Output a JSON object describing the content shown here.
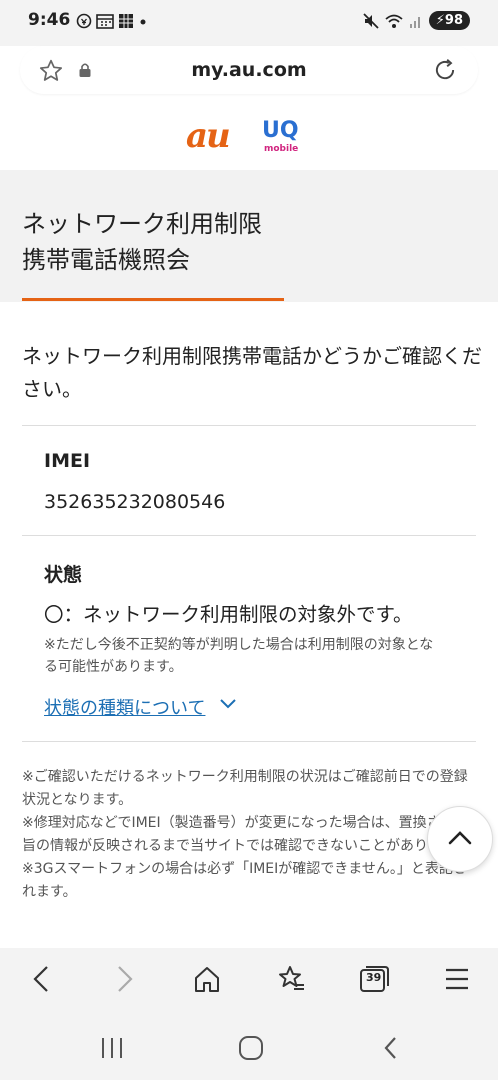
{
  "status_bar": {
    "time": "9:46",
    "battery": "98"
  },
  "browser": {
    "url": "my.au.com",
    "tab_count": "39"
  },
  "logos": {
    "au": "au",
    "uq": "UQ",
    "uq_sub": "mobile"
  },
  "page": {
    "title_line1": "ネットワーク利用制限",
    "title_line2": "携帯電話機照会",
    "intro": "ネットワーク利用制限携帯電話かどうかご確認ください。",
    "imei_label": "IMEI",
    "imei_value": "352635232080546",
    "status_label": "状態",
    "status_value": "〇：ネットワーク利用制限の対象外です。",
    "status_note": "※ただし今後不正契約等が判明した場合は利用制限の対象となる可能性があります。",
    "types_link": "状態の種類について",
    "footnotes": [
      "※ご確認いただけるネットワーク利用制限の状況はご確認前日での登録状況となります。",
      "※修理対応などでIMEI（製造番号）が変更になった場合は、置換された旨の情報が反映されるまで当サイトでは確認できないことがあります。",
      "※3Gスマートフォンの場合は必ず「IMEIが確認できません。」と表記されます。"
    ]
  },
  "colors": {
    "accent": "#e56315",
    "link": "#1c6fb4",
    "uq_blue": "#2a6fd1",
    "uq_pink": "#d1247f"
  }
}
